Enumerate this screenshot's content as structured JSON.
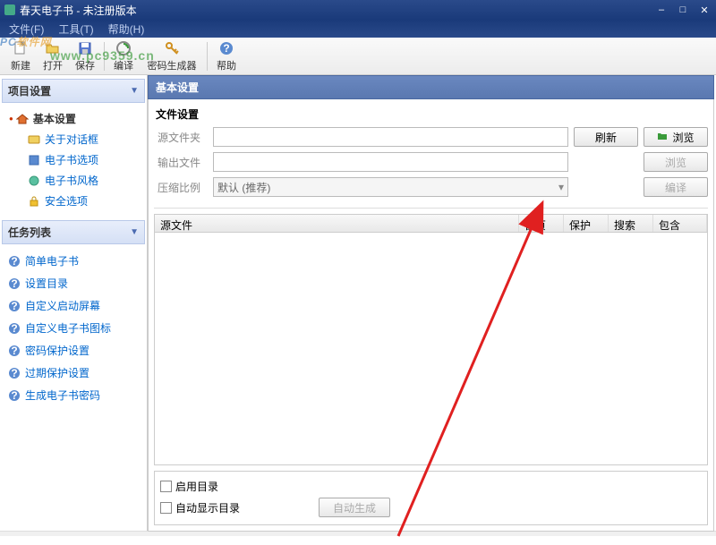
{
  "window": {
    "title": "春天电子书 - 未注册版本"
  },
  "menu": {
    "file": "文件(F)",
    "tools": "工具(T)",
    "help": "帮助(H)"
  },
  "toolbar": {
    "new": "新建",
    "open": "打开",
    "save": "保存",
    "compile": "编译",
    "pwdgen": "密码生成器",
    "help": "帮助"
  },
  "sidebar": {
    "project_head": "项目设置",
    "tree": {
      "root": "基本设置",
      "items": [
        "关于对话框",
        "电子书选项",
        "电子书风格",
        "安全选项"
      ]
    },
    "tasks_head": "任务列表",
    "tasks": [
      "简单电子书",
      "设置目录",
      "自定义启动屏幕",
      "自定义电子书图标",
      "密码保护设置",
      "过期保护设置",
      "生成电子书密码"
    ]
  },
  "panel": {
    "title": "基本设置",
    "file_settings": "文件设置",
    "rows": {
      "src": {
        "label": "源文件夹",
        "value": "",
        "btn_refresh": "刷新",
        "btn_browse": "浏览"
      },
      "out": {
        "label": "输出文件",
        "value": "",
        "btn_browse": "浏览"
      },
      "zip": {
        "label": "压缩比例",
        "value": "默认 (推荐)",
        "btn_compile": "编译"
      }
    },
    "list": {
      "cols": [
        "源文件",
        "首页",
        "保护",
        "搜索",
        "包含"
      ]
    },
    "opts": {
      "enable_toc": "启用目录",
      "auto_show_toc": "自动显示目录",
      "btn_gen": "自动生成"
    }
  },
  "watermark": {
    "text1": "PC",
    "text2": "软件网",
    "url": "www.pc9359.cn"
  }
}
